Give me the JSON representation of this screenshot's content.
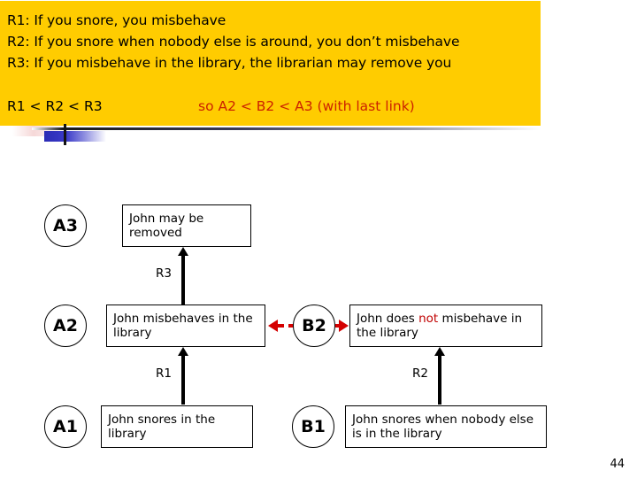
{
  "header": {
    "rules": [
      "R1: If you snore, you misbehave",
      "R2: If you snore when nobody else is around, you don’t misbehave",
      "R3: If you misbehave in the library, the librarian may remove you"
    ],
    "ordering_rules": "R1 < R2 < R3",
    "ordering_conclusion": "so A2 < B2 < A3 (with last link)",
    "background_color": "#FFCC00",
    "conclusion_color": "#CC2200"
  },
  "diagram": {
    "nodes": [
      {
        "id": "A3",
        "label": "A3"
      },
      {
        "id": "A2",
        "label": "A2"
      },
      {
        "id": "B2",
        "label": "B2"
      },
      {
        "id": "A1",
        "label": "A1"
      },
      {
        "id": "B1",
        "label": "B1"
      }
    ],
    "boxes": {
      "a3_claim": "John may be removed",
      "a2_claim": "John misbehaves in the library",
      "b2_claim_pre": "John does ",
      "b2_claim_neg": "not",
      "b2_claim_post": " misbehave in the library",
      "a1_claim": "John snores in the library",
      "b1_claim": "John snores when nobody else is in the library"
    },
    "edge_labels": {
      "a2_to_a3": "R3",
      "a1_to_a2": "R1",
      "b1_to_b2": "R2"
    },
    "attack_color": "#D40000",
    "negation_color": "#C00000"
  },
  "footer": {
    "page_number": "44"
  }
}
